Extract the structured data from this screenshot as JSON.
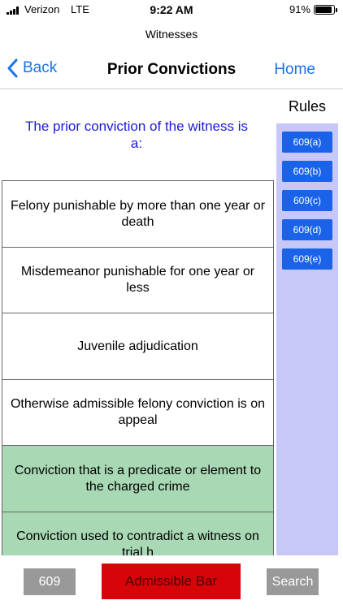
{
  "status_bar": {
    "carrier": "Verizon",
    "network": "LTE",
    "time": "9:22 AM",
    "battery": "91%",
    "battery_level": 0.91
  },
  "nav": {
    "subtitle": "Witnesses",
    "back_label": "Back",
    "title": "Prior Convictions",
    "home_label": "Home"
  },
  "question": "The prior conviction of the witness is a:",
  "options": [
    {
      "label": "Felony punishable by more than one year or death",
      "highlighted": false
    },
    {
      "label": "Misdemeanor punishable for one year or less",
      "highlighted": false
    },
    {
      "label": "Juvenile adjudication",
      "highlighted": false
    },
    {
      "label": "Otherwise admissible felony conviction is on appeal",
      "highlighted": false
    },
    {
      "label": "Conviction that is a predicate or element to the charged crime",
      "highlighted": true
    },
    {
      "label": "Conviction used to contradict a witness on trial h",
      "highlighted": true
    }
  ],
  "rules": {
    "title": "Rules",
    "items": [
      "609(a)",
      "609(b)",
      "609(c)",
      "609(d)",
      "609(e)"
    ]
  },
  "toolbar": {
    "rule_label": "609",
    "admissible_label": "Admissible Bar",
    "search_label": "Search"
  },
  "colors": {
    "accent": "#1a73e8",
    "question_text": "#1a1adb",
    "highlight_green": "#a8d8b4",
    "rules_panel": "#c8c8f8",
    "rule_button": "#1a63e8",
    "admissible_red": "#d7050a"
  }
}
